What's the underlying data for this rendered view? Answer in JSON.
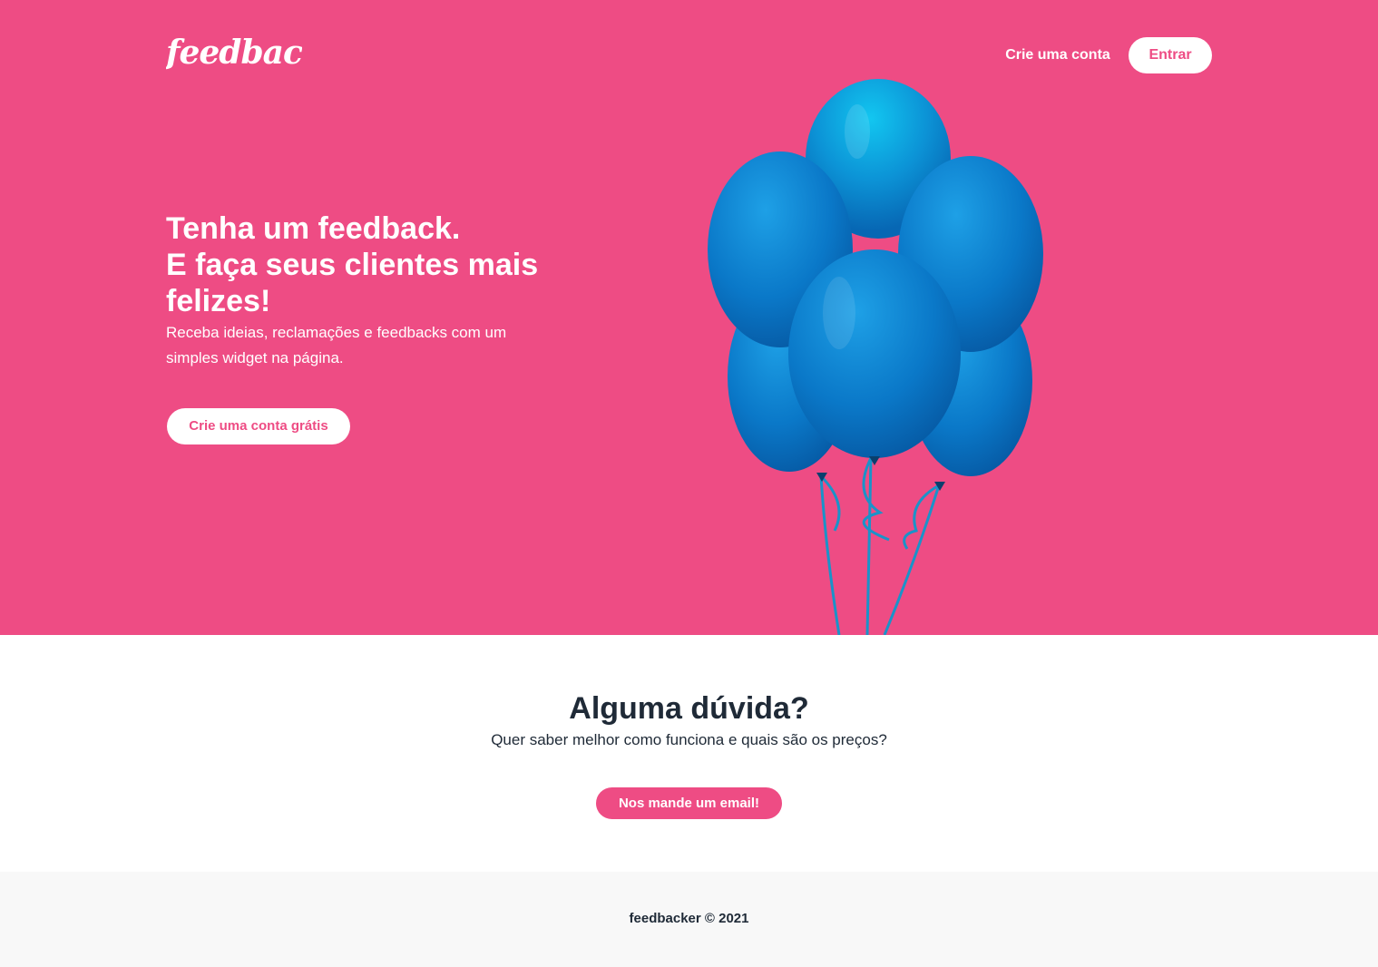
{
  "brand": {
    "logo_text": "feedbacker",
    "primary_color": "#ee4c84"
  },
  "nav": {
    "create_account_label": "Crie uma conta",
    "login_label": "Entrar"
  },
  "hero": {
    "headline_lines": [
      "Tenha um feedback.",
      "E faça seus clientes mais",
      "felizes!"
    ],
    "subtext": "Receba ideias, reclamações e feedbacks com um simples widget na página.",
    "cta_label": "Crie uma conta grátis",
    "image": "blue-balloons"
  },
  "faq": {
    "title": "Alguma dúvida?",
    "subtitle": "Quer saber melhor como funciona e quais são os preços?",
    "button_label": "Nos mande um email!"
  },
  "footer": {
    "text": "feedbacker © 2021"
  }
}
